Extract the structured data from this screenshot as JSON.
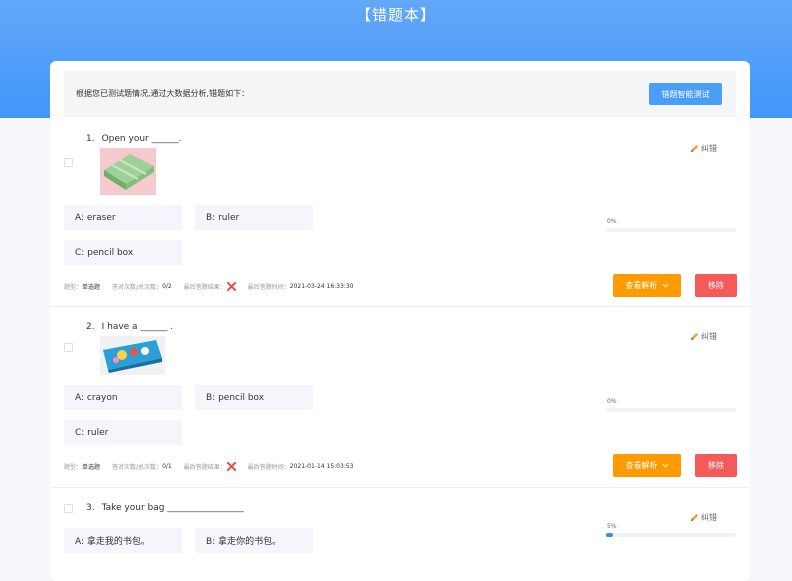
{
  "page": {
    "title": "【错题本】"
  },
  "info": {
    "text": "根据您已测试题情况,通过大数据分析,错题如下：",
    "smart_test_label": "错题智能测试"
  },
  "labels": {
    "correct": "纠错",
    "analysis": "查看解析",
    "remove": "移除",
    "type": "题型：",
    "ratio": "答对次数/总次数：",
    "last_result": "最后答题结果：",
    "last_time": "最后答题时间："
  },
  "questions": [
    {
      "number": "1.",
      "stem": "Open your ______.",
      "options": [
        "A: eraser",
        "B: ruler",
        "C: pencil box"
      ],
      "percent": "0%",
      "percent_value": 0,
      "type": "单选题",
      "ratio": "0/2",
      "last_time": "2021-03-24 16:33:30"
    },
    {
      "number": "2.",
      "stem": "I have a ______ .",
      "options": [
        "A: crayon",
        "B: pencil box",
        "C: ruler"
      ],
      "percent": "0%",
      "percent_value": 0,
      "type": "单选题",
      "ratio": "0/1",
      "last_time": "2021-01-14 15:03:53"
    },
    {
      "number": "3.",
      "stem": "Take your bag _________________",
      "options": [
        "A: 拿走我的书包。",
        "B: 拿走你的书包。"
      ],
      "percent": "5%",
      "percent_value": 5
    }
  ],
  "colors": {
    "header": "#4096fa",
    "primary": "#4a9ef8",
    "analysis": "#ff9a00",
    "remove": "#f55a5a",
    "progress": "#3a8ee6"
  }
}
